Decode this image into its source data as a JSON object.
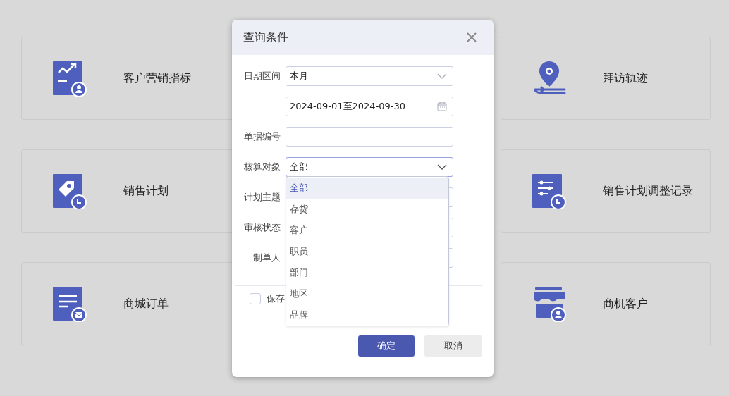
{
  "cards": [
    {
      "label": "客户营销指标",
      "kind": "chart"
    },
    {
      "label": "拜访轨迹",
      "kind": "location"
    },
    {
      "label": "销售计划",
      "kind": "tag"
    },
    {
      "label": "销售计划调整记录",
      "kind": "sliders"
    },
    {
      "label": "商城订单",
      "kind": "order"
    },
    {
      "label": "商机客户",
      "kind": "shop"
    }
  ],
  "dialog": {
    "title": "查询条件",
    "fields": [
      {
        "label": "日期区间",
        "kind": "select",
        "value": "本月",
        "open": false
      },
      {
        "kind": "date",
        "value": "2024-09-01至2024-09-30"
      },
      {
        "label": "单据编号",
        "kind": "text"
      },
      {
        "label": "核算对象",
        "kind": "select",
        "value": "全部",
        "open": true,
        "options": [
          {
            "label": "全部",
            "selected": true
          },
          {
            "label": "存货",
            "selected": false
          },
          {
            "label": "客户",
            "selected": false
          },
          {
            "label": "职员",
            "selected": false
          },
          {
            "label": "部门",
            "selected": false
          },
          {
            "label": "地区",
            "selected": false
          },
          {
            "label": "品牌",
            "selected": false
          }
        ]
      },
      {
        "label": "计划主题",
        "kind": "text"
      },
      {
        "label": "审核状态",
        "kind": "text"
      },
      {
        "label": "制单人",
        "kind": "text"
      }
    ],
    "checkbox": {
      "label": "保存",
      "checked": false
    },
    "buttons": [
      {
        "label": "确定",
        "primary": true
      },
      {
        "label": "取消",
        "primary": false
      }
    ]
  }
}
